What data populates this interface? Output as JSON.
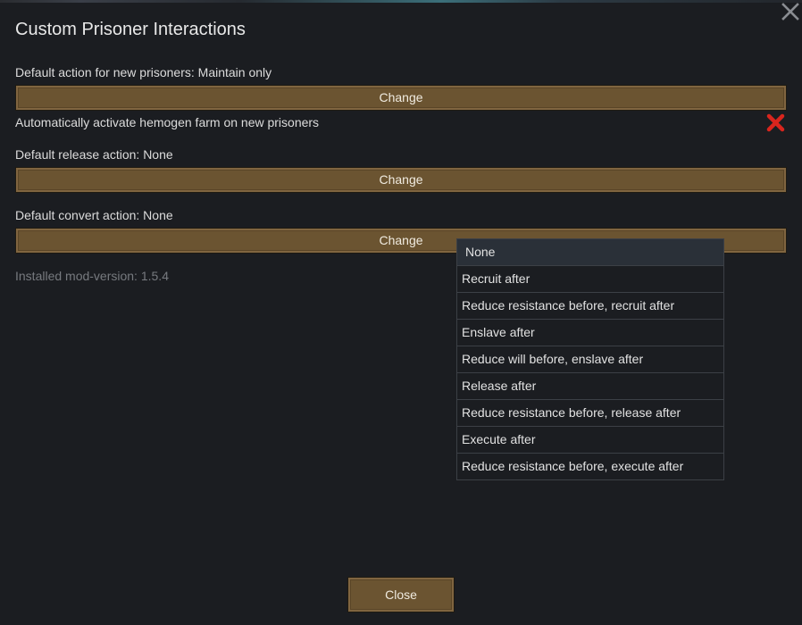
{
  "window": {
    "title": "Custom Prisoner Interactions",
    "close_icon": "close-icon"
  },
  "settings": {
    "default_action_label": "Default action for new prisoners: Maintain only",
    "default_action_button": "Change",
    "hemogen_label": "Automatically activate hemogen farm on new prisoners",
    "hemogen_checked": false,
    "hemogen_icon": "red-x-icon",
    "release_label": "Default release action: None",
    "release_button": "Change",
    "convert_label": "Default convert action: None",
    "convert_button": "Change",
    "version_text": "Installed mod-version: 1.5.4"
  },
  "dropdown": {
    "items": [
      {
        "label": "None"
      },
      {
        "label": "Recruit after"
      },
      {
        "label": "Reduce resistance before, recruit after"
      },
      {
        "label": "Enslave after"
      },
      {
        "label": "Reduce will before, enslave after"
      },
      {
        "label": "Release after"
      },
      {
        "label": "Reduce resistance before, release after"
      },
      {
        "label": "Execute after"
      },
      {
        "label": "Reduce resistance before, execute after"
      }
    ]
  },
  "footer": {
    "close_label": "Close"
  },
  "colors": {
    "background": "#1b1d21",
    "button": "#6b5431",
    "red_x": "#d9251d",
    "muted_text": "#777a7f"
  }
}
